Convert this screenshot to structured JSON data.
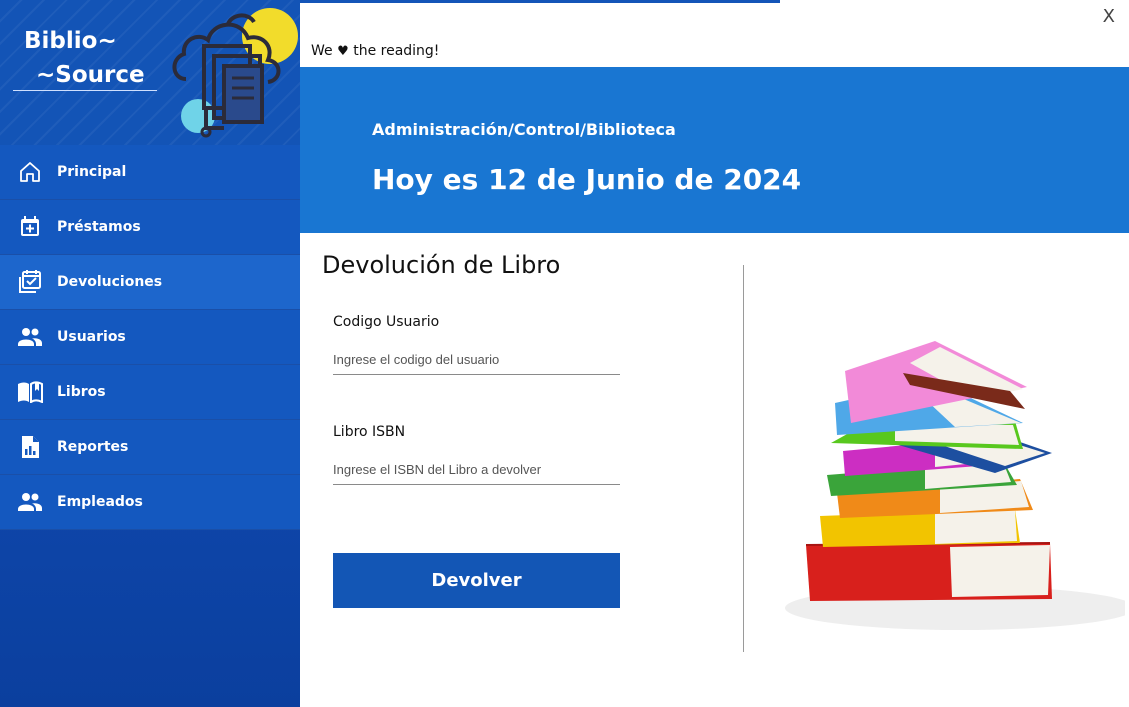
{
  "window": {
    "close_label": "X"
  },
  "brand": {
    "line1": "Biblio~",
    "line2": "~Source"
  },
  "topbar": {
    "tagline_pre": "We",
    "tagline_post": "the reading!"
  },
  "sidebar": {
    "items": [
      {
        "label": "Principal",
        "icon": "home-icon"
      },
      {
        "label": "Préstamos",
        "icon": "calendar-plus-icon"
      },
      {
        "label": "Devoluciones",
        "icon": "calendar-check-icon",
        "active": true
      },
      {
        "label": "Usuarios",
        "icon": "users-icon"
      },
      {
        "label": "Libros",
        "icon": "open-book-icon"
      },
      {
        "label": "Reportes",
        "icon": "report-file-icon"
      },
      {
        "label": "Empleados",
        "icon": "users-icon"
      }
    ]
  },
  "header": {
    "breadcrumb": "Administración/Control/Biblioteca",
    "date_text": "Hoy es 12 de Junio de 2024"
  },
  "form": {
    "title": "Devolución de Libro",
    "user_label": "Codigo Usuario",
    "user_placeholder": "Ingrese el codigo del usuario",
    "isbn_label": "Libro ISBN",
    "isbn_placeholder": "Ingrese el ISBN del Libro a devolver",
    "submit_label": "Devolver"
  },
  "colors": {
    "sidebar": "#1458bf",
    "sidebar_active": "#1d66cc",
    "banner": "#1976d2",
    "button": "#1356b5"
  }
}
